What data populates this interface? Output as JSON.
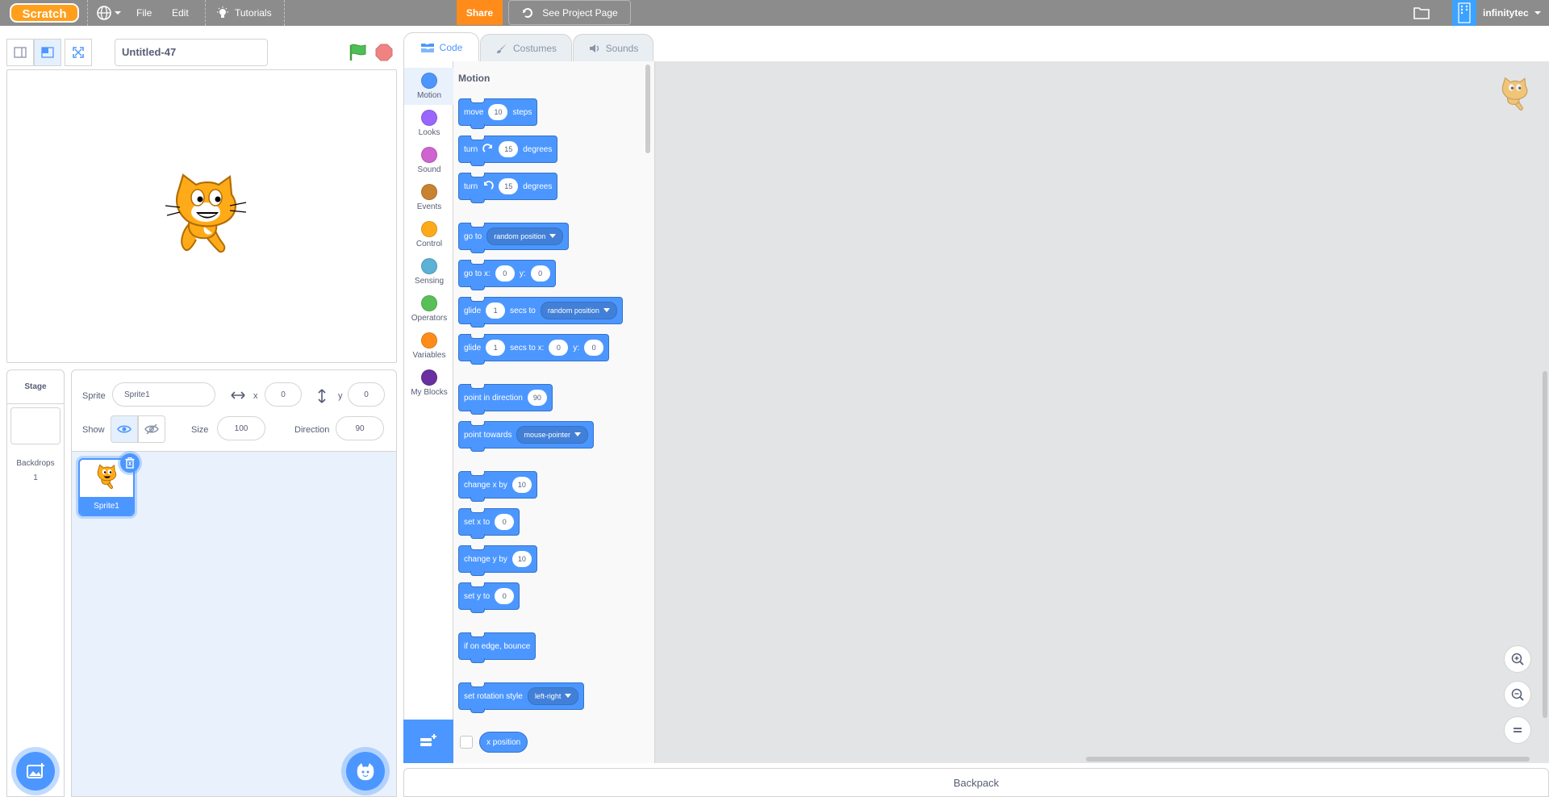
{
  "menu": {
    "logo": "Scratch",
    "file": "File",
    "edit": "Edit",
    "tutorials": "Tutorials",
    "share": "Share",
    "see_project": "See Project Page",
    "username": "infinitytec"
  },
  "stage": {
    "project_title": "Untitled-47"
  },
  "sprite_info": {
    "sprite_label": "Sprite",
    "sprite_name": "Sprite1",
    "x_label": "x",
    "x_value": "0",
    "y_label": "y",
    "y_value": "0",
    "show_label": "Show",
    "size_label": "Size",
    "size_value": "100",
    "direction_label": "Direction",
    "direction_value": "90"
  },
  "sprites": [
    {
      "name": "Sprite1"
    }
  ],
  "stage_pane": {
    "title": "Stage",
    "backdrops_label": "Backdrops",
    "backdrops_count": "1"
  },
  "tabs": {
    "code": "Code",
    "costumes": "Costumes",
    "sounds": "Sounds"
  },
  "categories": [
    {
      "label": "Motion",
      "color": "#4c97ff"
    },
    {
      "label": "Looks",
      "color": "#9966ff"
    },
    {
      "label": "Sound",
      "color": "#cf63cf"
    },
    {
      "label": "Events",
      "color": "#ffbf00"
    },
    {
      "label": "Control",
      "color": "#ffab19"
    },
    {
      "label": "Sensing",
      "color": "#5cb1d6"
    },
    {
      "label": "Operators",
      "color": "#59c059"
    },
    {
      "label": "Variables",
      "color": "#ff8c1a"
    },
    {
      "label": "My Blocks",
      "color": "#ff6680"
    }
  ],
  "flyout": {
    "title": "Motion",
    "move": {
      "a": "move",
      "n": "10",
      "b": "steps"
    },
    "turn_cw": {
      "a": "turn",
      "n": "15",
      "b": "degrees"
    },
    "turn_ccw": {
      "a": "turn",
      "n": "15",
      "b": "degrees"
    },
    "goto": {
      "a": "go to",
      "dd": "random position"
    },
    "goto_xy": {
      "a": "go to x:",
      "x": "0",
      "y_label": "y:",
      "y": "0"
    },
    "glide_to": {
      "a": "glide",
      "n": "1",
      "b": "secs to",
      "dd": "random position"
    },
    "glide_xy": {
      "a": "glide",
      "n": "1",
      "b": "secs to x:",
      "x": "0",
      "y_label": "y:",
      "y": "0"
    },
    "point_dir": {
      "a": "point in direction",
      "n": "90"
    },
    "point_towards": {
      "a": "point towards",
      "dd": "mouse-pointer"
    },
    "change_x": {
      "a": "change x by",
      "n": "10"
    },
    "set_x": {
      "a": "set x to",
      "n": "0"
    },
    "change_y": {
      "a": "change y by",
      "n": "10"
    },
    "set_y": {
      "a": "set y to",
      "n": "0"
    },
    "bounce": {
      "a": "if on edge, bounce"
    },
    "rotation": {
      "a": "set rotation style",
      "dd": "left-right"
    },
    "x_position": "x position"
  },
  "backpack": "Backpack"
}
